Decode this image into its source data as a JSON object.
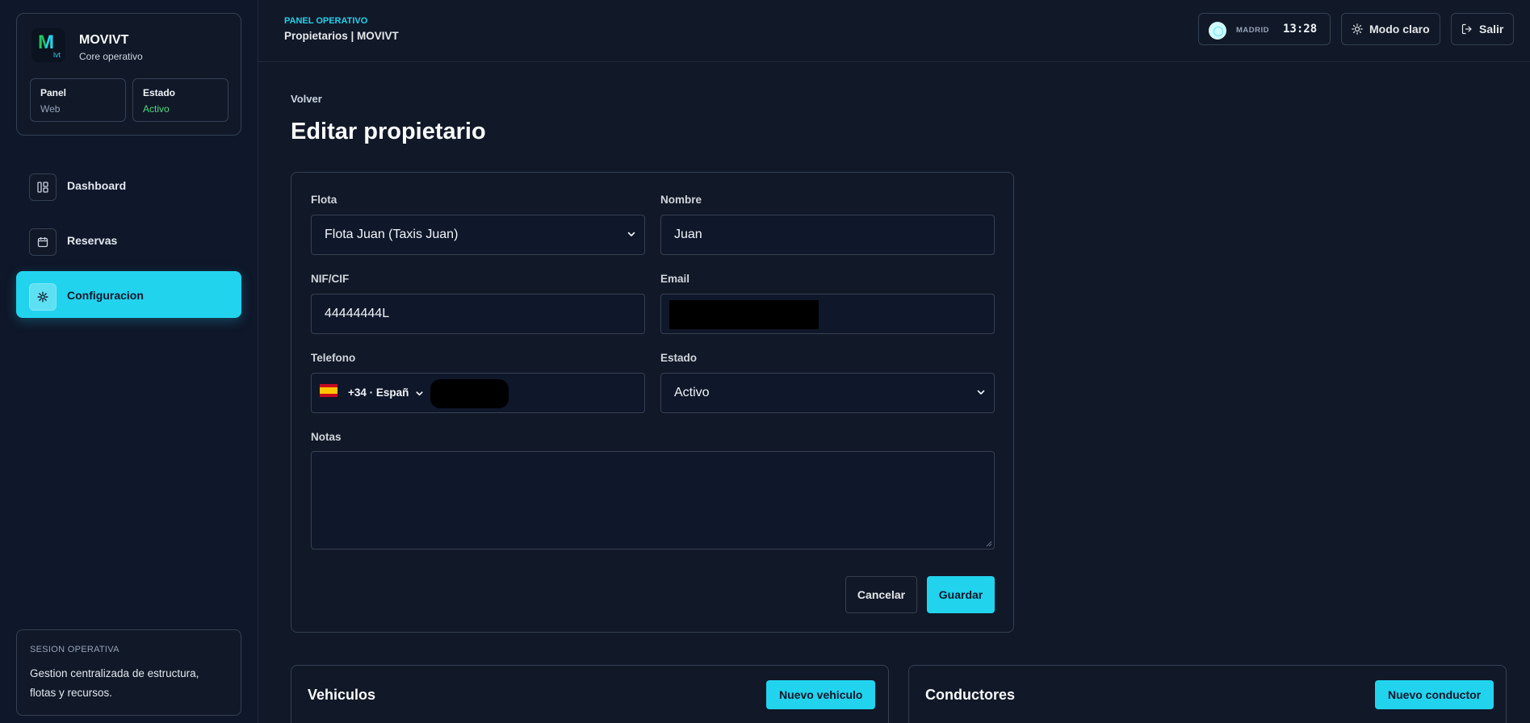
{
  "brand": {
    "name": "MOVIVT",
    "subtitle": "Core operativo",
    "logo_letter": "M",
    "logo_small": "lvt"
  },
  "status_cards": [
    {
      "label": "Panel",
      "value": "Web"
    },
    {
      "label": "Estado",
      "value": "Activo"
    }
  ],
  "nav": [
    {
      "label": "Dashboard",
      "icon": "dashboard-icon",
      "active": false
    },
    {
      "label": "Reservas",
      "icon": "calendar-icon",
      "active": false
    },
    {
      "label": "Configuracion",
      "icon": "gear-icon",
      "active": true
    }
  ],
  "session": {
    "heading": "SESION OPERATIVA",
    "text": "Gestion centralizada de estructura, flotas y recursos."
  },
  "topbar": {
    "eyebrow": "PANEL OPERATIVO",
    "title": "Propietarios | MOVIVT",
    "city": "MADRID",
    "time": "13:28",
    "theme_label": "Modo claro",
    "logout_label": "Salir"
  },
  "page": {
    "back_label": "Volver",
    "title": "Editar propietario"
  },
  "form": {
    "flota_label": "Flota",
    "flota_value": "Flota Juan (Taxis Juan)",
    "nombre_label": "Nombre",
    "nombre_value": "Juan",
    "nif_label": "NIF/CIF",
    "nif_value": "44444444L",
    "email_label": "Email",
    "email_value": "",
    "telefono_label": "Telefono",
    "phone_prefix": "+34 · Españ",
    "phone_value": "",
    "estado_label": "Estado",
    "estado_value": "Activo",
    "notas_label": "Notas",
    "notas_value": "",
    "cancel_label": "Cancelar",
    "save_label": "Guardar"
  },
  "sections": {
    "vehiculos_title": "Vehiculos",
    "vehiculos_button": "Nuevo vehiculo",
    "conductores_title": "Conductores",
    "conductores_button": "Nuevo conductor"
  },
  "colors": {
    "accent": "#22d3ee",
    "background": "#111827",
    "success": "#4ade80"
  }
}
